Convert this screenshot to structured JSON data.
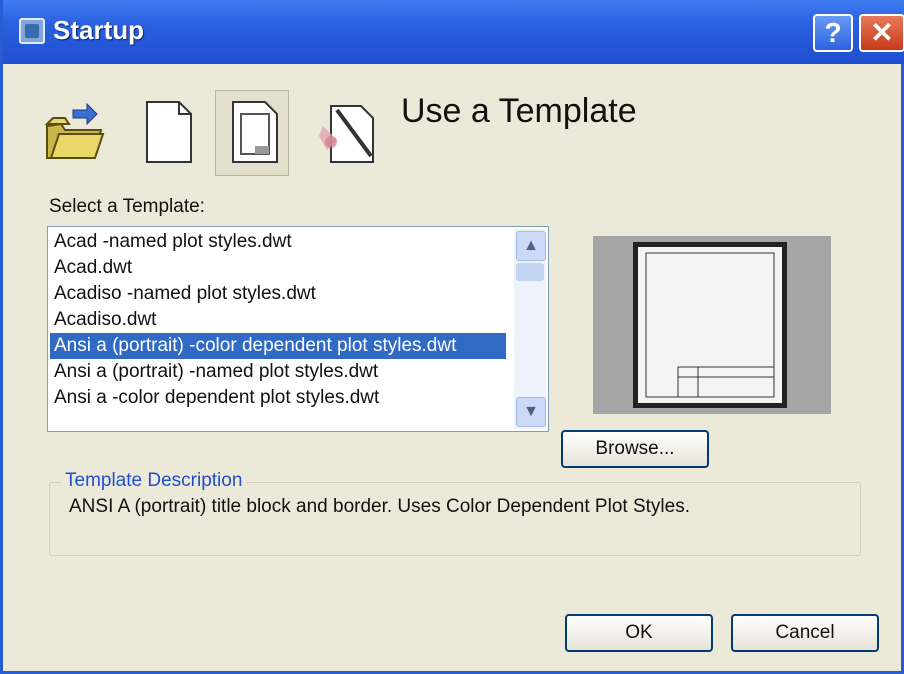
{
  "window": {
    "title": "Startup"
  },
  "titlebar": {
    "help_label": "?",
    "close_label": "✕"
  },
  "toolbar": {
    "icons": [
      "open-folder-icon",
      "blank-page-icon",
      "template-page-icon",
      "wizard-icon"
    ],
    "heading": "Use a Template"
  },
  "select": {
    "label": "Select a Template:",
    "items": [
      "Acad -named plot styles.dwt",
      "Acad.dwt",
      "Acadiso -named plot styles.dwt",
      "Acadiso.dwt",
      "Ansi a (portrait) -color dependent plot styles.dwt",
      "Ansi a (portrait) -named plot styles.dwt",
      "Ansi a -color dependent plot styles.dwt"
    ],
    "selected_index": 4
  },
  "buttons": {
    "browse": "Browse...",
    "ok": "OK",
    "cancel": "Cancel"
  },
  "description": {
    "title": "Template Description",
    "text": "ANSI A (portrait) title block and border. Uses Color Dependent Plot Styles."
  },
  "colors": {
    "titlebar": "#2a5fe0",
    "selection": "#316ac5",
    "group_title": "#1f4fd0"
  }
}
